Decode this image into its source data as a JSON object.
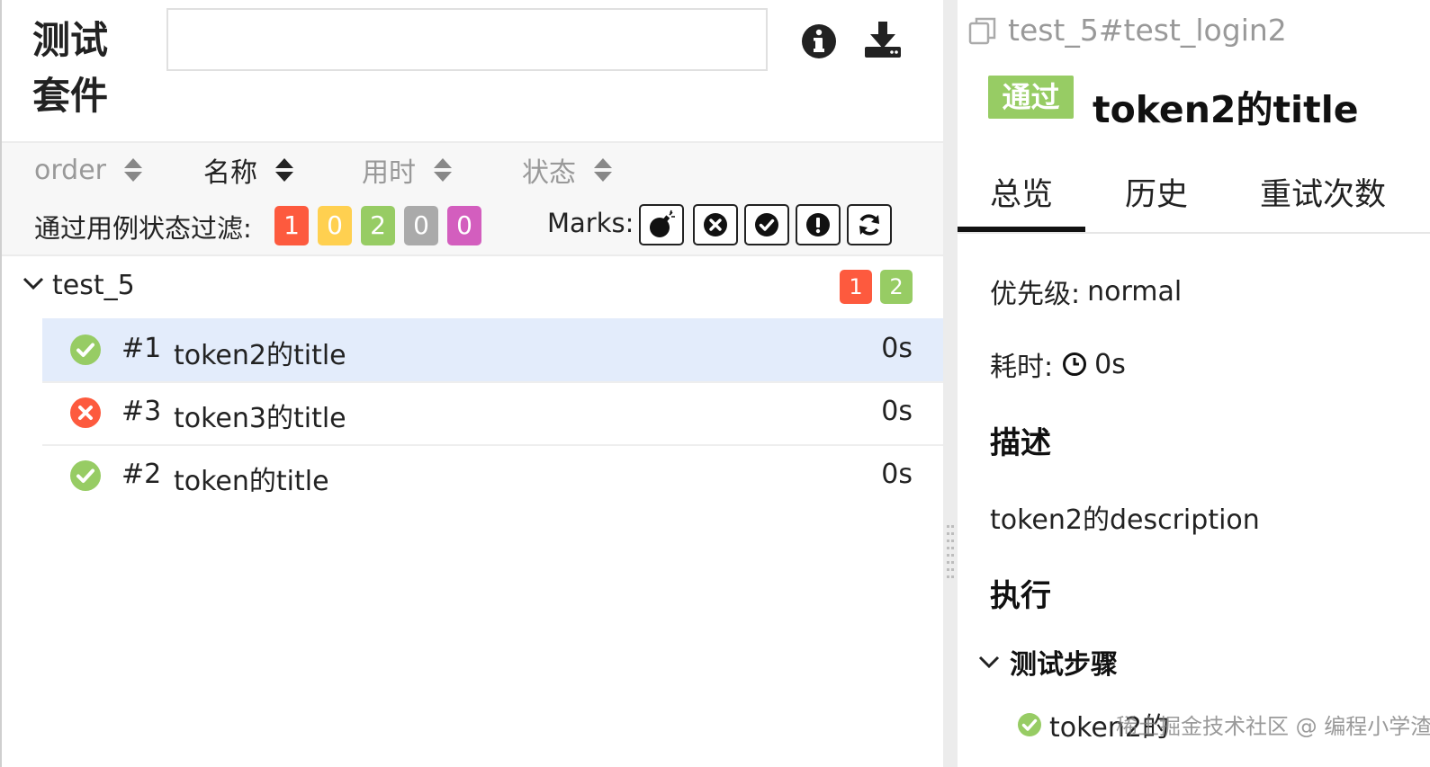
{
  "left": {
    "suite_title": "测试套件",
    "search": {
      "value": "",
      "placeholder": ""
    },
    "header_icons": [
      "info-icon",
      "download-icon"
    ],
    "sort": [
      {
        "label": "order",
        "active": false
      },
      {
        "label": "名称",
        "active": true
      },
      {
        "label": "用时",
        "active": false
      },
      {
        "label": "状态",
        "active": false
      }
    ],
    "filter": {
      "label": "通过用例状态过滤:",
      "chips": [
        {
          "value": "1",
          "color": "#fd5a3e"
        },
        {
          "value": "0",
          "color": "#ffd050"
        },
        {
          "value": "2",
          "color": "#97cc64"
        },
        {
          "value": "0",
          "color": "#aaaaaa"
        },
        {
          "value": "0",
          "color": "#d35ebe"
        }
      ]
    },
    "marks": {
      "label": "Marks:",
      "buttons": [
        "bomb-icon",
        "x-circle-icon",
        "check-circle-icon",
        "exclamation-circle-icon",
        "refresh-icon"
      ]
    },
    "group": {
      "name": "test_5",
      "badges": [
        {
          "value": "1",
          "color": "#fd5a3e"
        },
        {
          "value": "2",
          "color": "#97cc64"
        }
      ]
    },
    "tests": [
      {
        "num": "#1",
        "name": "token2的title",
        "duration": "0s",
        "status": "passed",
        "selected": true
      },
      {
        "num": "#3",
        "name": "token3的title",
        "duration": "0s",
        "status": "failed",
        "selected": false
      },
      {
        "num": "#2",
        "name": "token的title",
        "duration": "0s",
        "status": "passed",
        "selected": false
      }
    ]
  },
  "right": {
    "breadcrumb": "test_5#test_login2",
    "status_tag": "通过",
    "title": "token2的title",
    "tabs": [
      "总览",
      "历史",
      "重试次数"
    ],
    "active_tab": "总览",
    "priority_label": "优先级:",
    "priority_value": "normal",
    "duration_label": "耗时:",
    "duration_value": "0s",
    "description_heading": "描述",
    "description": "token2的description",
    "execution_heading": "执行",
    "steps_heading": "测试步骤",
    "step_text": "token2的"
  },
  "watermark": "稀土掘金技术社区 @ 编程小学渣",
  "colors": {
    "passed": "#97cc64",
    "failed": "#fd5a3e",
    "selected_row": "#e3ecfb"
  }
}
